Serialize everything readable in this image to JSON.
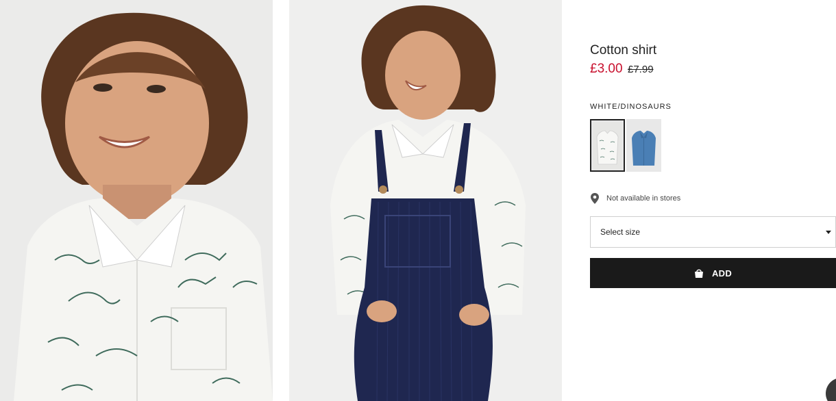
{
  "product": {
    "title": "Cotton shirt",
    "price_sale": "£3.00",
    "price_original": "£7.99",
    "color_name": "WHITE/DINOSAURS",
    "swatches": [
      {
        "name": "White/Dinosaurs",
        "color": "#f1f1ef",
        "selected": true
      },
      {
        "name": "Denim blue",
        "color": "#4a7fb5",
        "selected": false
      }
    ],
    "store_availability": "Not available in stores",
    "size_select_label": "Select size",
    "add_button_label": "ADD"
  },
  "icons": {
    "location": "pin-icon",
    "bag": "bag-icon",
    "caret": "chevron-down-icon"
  },
  "colors": {
    "sale_price": "#c8102e",
    "add_button_bg": "#1a1a1a",
    "text": "#222222"
  }
}
